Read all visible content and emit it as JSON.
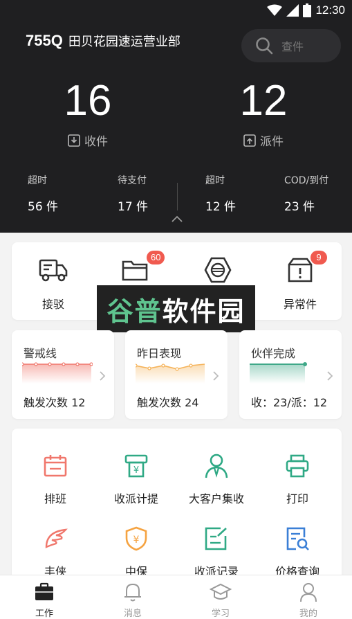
{
  "status_bar": {
    "time": "12:30"
  },
  "header": {
    "station_code": "755Q",
    "station_name": "田贝花园速运营业部",
    "search_placeholder": "查件"
  },
  "counts": {
    "receive": {
      "value": "16",
      "label": "收件"
    },
    "dispatch": {
      "value": "12",
      "label": "派件"
    }
  },
  "stats": [
    {
      "label": "超时",
      "value": "56 件"
    },
    {
      "label": "待支付",
      "value": "17 件"
    },
    {
      "label": "超时",
      "value": "12 件"
    },
    {
      "label": "COD/到付",
      "value": "23 件"
    }
  ],
  "quick_actions": [
    {
      "label": "接驳",
      "icon": "truck-icon",
      "badge": ""
    },
    {
      "label": "",
      "icon": "folder-icon",
      "badge": "60"
    },
    {
      "label": "",
      "icon": "scanner-icon",
      "badge": ""
    },
    {
      "label": "异常件",
      "icon": "box-alert-icon",
      "badge": "9"
    }
  ],
  "watermark": {
    "part1": "谷普",
    "part2": "软件园"
  },
  "metrics": [
    {
      "title": "警戒线",
      "value": "触发次数 12",
      "color": "#f0776c"
    },
    {
      "title": "昨日表现",
      "value": "触发次数 24",
      "color": "#f5b35a"
    },
    {
      "title": "伙伴完成",
      "value": "收：23/派：12",
      "color": "#3fa888"
    }
  ],
  "tools": [
    {
      "label": "排班",
      "icon": "calendar-icon",
      "color": "#f0776c"
    },
    {
      "label": "收派计提",
      "icon": "cash-register-icon",
      "color": "#2fa985"
    },
    {
      "label": "大客户集收",
      "icon": "person-tie-icon",
      "color": "#2fa985"
    },
    {
      "label": "打印",
      "icon": "printer-icon",
      "color": "#2fa985"
    },
    {
      "label": "丰侠",
      "icon": "feather-icon",
      "color": "#f0776c"
    },
    {
      "label": "中保",
      "icon": "shield-yen-icon",
      "color": "#f5a341"
    },
    {
      "label": "收派记录",
      "icon": "edit-note-icon",
      "color": "#2fa985"
    },
    {
      "label": "价格查询",
      "icon": "price-search-icon",
      "color": "#3a7fd6"
    }
  ],
  "bottom_nav": [
    {
      "label": "工作",
      "icon": "briefcase-icon",
      "active": true
    },
    {
      "label": "消息",
      "icon": "bell-icon",
      "active": false
    },
    {
      "label": "学习",
      "icon": "graduation-cap-icon",
      "active": false
    },
    {
      "label": "我的",
      "icon": "user-icon",
      "active": false
    }
  ]
}
